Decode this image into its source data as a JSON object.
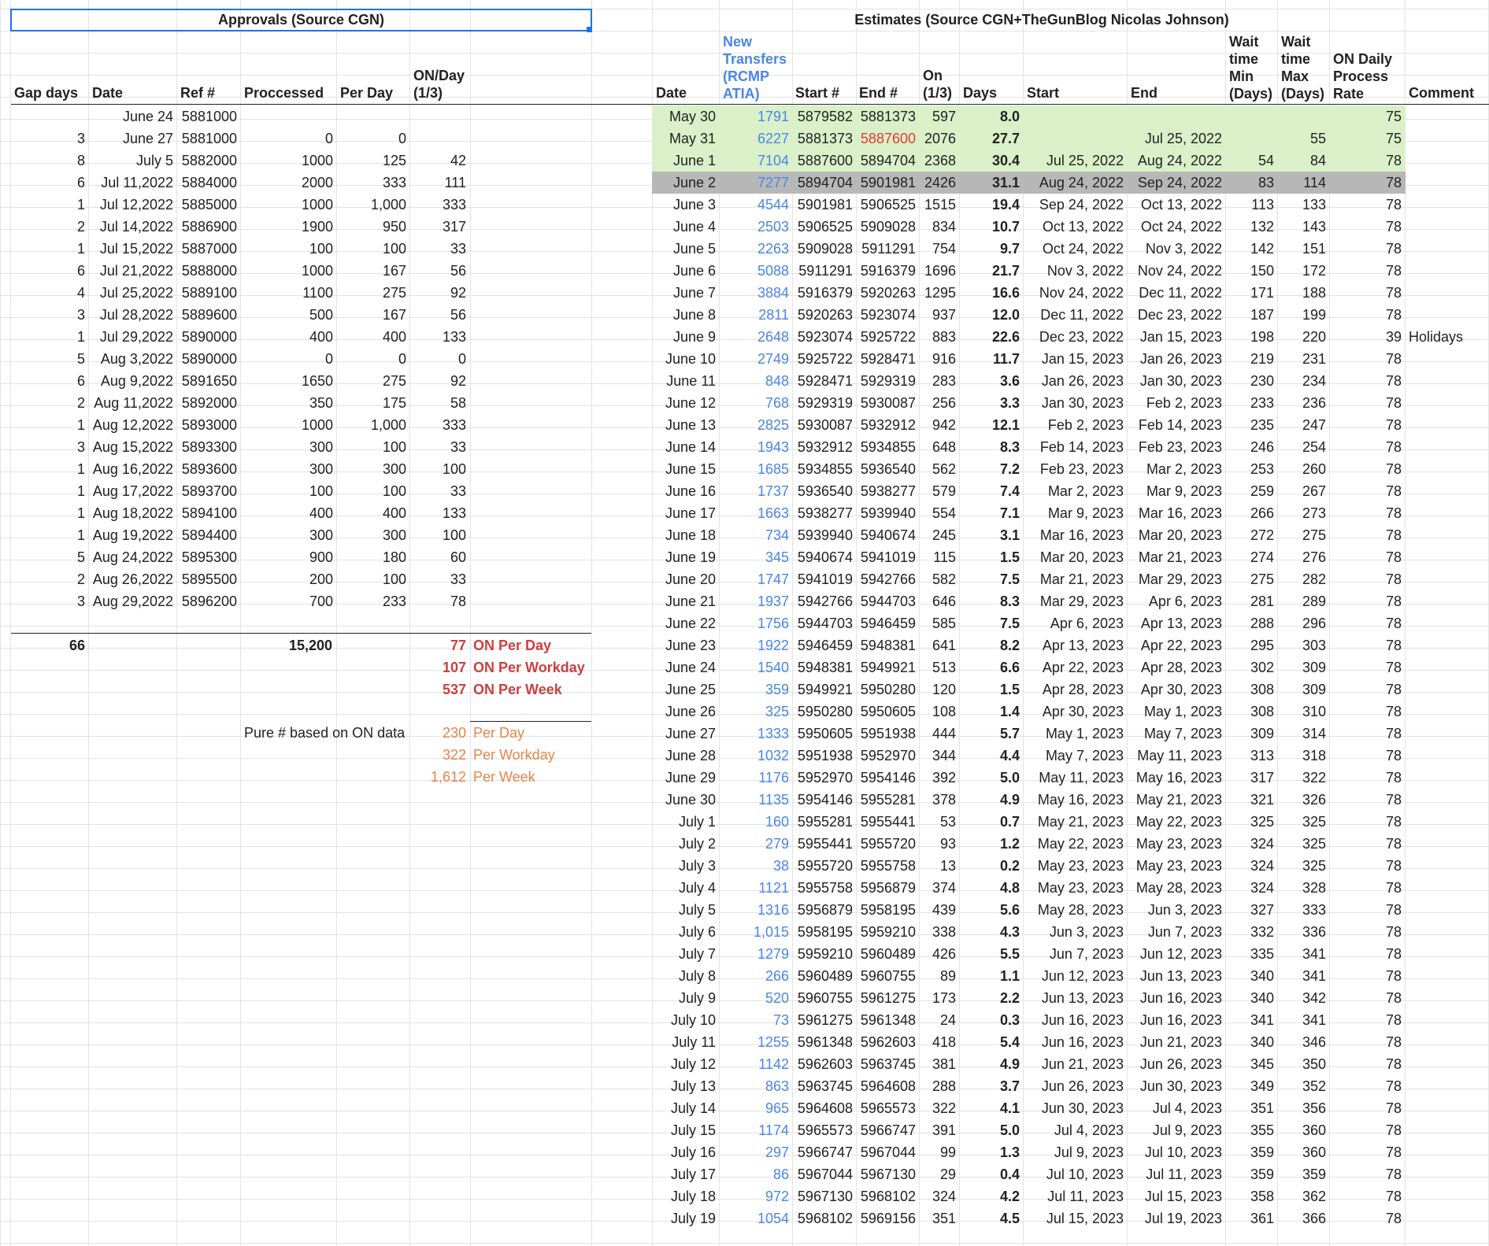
{
  "titles": {
    "approvals": "Approvals (Source CGN)",
    "estimates": "Estimates (Source CGN+TheGunBlog Nicolas Johnson)"
  },
  "left_headers": [
    "Gap days",
    "Date",
    "Ref #",
    "Proccessed",
    "Per Day",
    "ON/Day (1/3)"
  ],
  "left_rows": [
    {
      "gap": "",
      "date": "June 24",
      "ref": "5881000",
      "processed": "",
      "per_day": "",
      "on_day": ""
    },
    {
      "gap": "3",
      "date": "June 27",
      "ref": "5881000",
      "processed": "0",
      "per_day": "0",
      "on_day": ""
    },
    {
      "gap": "8",
      "date": "July 5",
      "ref": "5882000",
      "processed": "1000",
      "per_day": "125",
      "on_day": "42"
    },
    {
      "gap": "6",
      "date": "Jul 11,2022",
      "ref": "5884000",
      "processed": "2000",
      "per_day": "333",
      "on_day": "111"
    },
    {
      "gap": "1",
      "date": "Jul 12,2022",
      "ref": "5885000",
      "processed": "1000",
      "per_day": "1,000",
      "on_day": "333"
    },
    {
      "gap": "2",
      "date": "Jul 14,2022",
      "ref": "5886900",
      "processed": "1900",
      "per_day": "950",
      "on_day": "317"
    },
    {
      "gap": "1",
      "date": "Jul 15,2022",
      "ref": "5887000",
      "processed": "100",
      "per_day": "100",
      "on_day": "33"
    },
    {
      "gap": "6",
      "date": "Jul 21,2022",
      "ref": "5888000",
      "processed": "1000",
      "per_day": "167",
      "on_day": "56"
    },
    {
      "gap": "4",
      "date": "Jul 25,2022",
      "ref": "5889100",
      "processed": "1100",
      "per_day": "275",
      "on_day": "92"
    },
    {
      "gap": "3",
      "date": "Jul 28,2022",
      "ref": "5889600",
      "processed": "500",
      "per_day": "167",
      "on_day": "56"
    },
    {
      "gap": "1",
      "date": "Jul 29,2022",
      "ref": "5890000",
      "processed": "400",
      "per_day": "400",
      "on_day": "133"
    },
    {
      "gap": "5",
      "date": "Aug 3,2022",
      "ref": "5890000",
      "processed": "0",
      "per_day": "0",
      "on_day": "0"
    },
    {
      "gap": "6",
      "date": "Aug 9,2022",
      "ref": "5891650",
      "processed": "1650",
      "per_day": "275",
      "on_day": "92"
    },
    {
      "gap": "2",
      "date": "Aug 11,2022",
      "ref": "5892000",
      "processed": "350",
      "per_day": "175",
      "on_day": "58"
    },
    {
      "gap": "1",
      "date": "Aug 12,2022",
      "ref": "5893000",
      "processed": "1000",
      "per_day": "1,000",
      "on_day": "333"
    },
    {
      "gap": "3",
      "date": "Aug 15,2022",
      "ref": "5893300",
      "processed": "300",
      "per_day": "100",
      "on_day": "33"
    },
    {
      "gap": "1",
      "date": "Aug 16,2022",
      "ref": "5893600",
      "processed": "300",
      "per_day": "300",
      "on_day": "100"
    },
    {
      "gap": "1",
      "date": "Aug 17,2022",
      "ref": "5893700",
      "processed": "100",
      "per_day": "100",
      "on_day": "33"
    },
    {
      "gap": "1",
      "date": "Aug 18,2022",
      "ref": "5894100",
      "processed": "400",
      "per_day": "400",
      "on_day": "133"
    },
    {
      "gap": "1",
      "date": "Aug 19,2022",
      "ref": "5894400",
      "processed": "300",
      "per_day": "300",
      "on_day": "100"
    },
    {
      "gap": "5",
      "date": "Aug 24,2022",
      "ref": "5895300",
      "processed": "900",
      "per_day": "180",
      "on_day": "60"
    },
    {
      "gap": "2",
      "date": "Aug 26,2022",
      "ref": "5895500",
      "processed": "200",
      "per_day": "100",
      "on_day": "33"
    },
    {
      "gap": "3",
      "date": "Aug 29,2022",
      "ref": "5896200",
      "processed": "700",
      "per_day": "233",
      "on_day": "78"
    }
  ],
  "totals": {
    "gap_total": "66",
    "processed_total": "15,200",
    "on_per_day_value": "77",
    "on_per_day_label": "ON Per Day",
    "on_per_workday_value": "107",
    "on_per_workday_label": "ON Per Workday",
    "on_per_week_value": "537",
    "on_per_week_label": "ON Per Week",
    "pure_label": "Pure # based on ON data",
    "pure_per_day_value": "230",
    "pure_per_day_label": "Per Day",
    "pure_per_workday_value": "322",
    "pure_per_workday_label": "Per Workday",
    "pure_per_week_value": "1,612",
    "pure_per_week_label": "Per Week"
  },
  "right_headers": [
    "Date",
    "New Transfers (RCMP ATIA)",
    "Start #",
    "End #",
    "On (1/3)",
    "Days",
    "Start",
    "End",
    "Wait time Min (Days)",
    "Wait time Max (Days)",
    "ON Daily Process Rate",
    "Comment"
  ],
  "right_rows": [
    {
      "date": "May 30",
      "new": "1791",
      "start_n": "5879582",
      "end_n": "5881373",
      "on": "597",
      "days": "8.0",
      "start": "",
      "end": "",
      "wmin": "",
      "wmax": "",
      "rate": "75",
      "comment": "",
      "hl": "green"
    },
    {
      "date": "May 31",
      "new": "6227",
      "start_n": "5881373",
      "end_n": "5887600",
      "on": "2076",
      "days": "27.7",
      "start": "",
      "end": "Jul 25, 2022",
      "wmin": "",
      "wmax": "55",
      "rate": "75",
      "comment": "",
      "hl": "green",
      "end_red": true
    },
    {
      "date": "June 1",
      "new": "7104",
      "start_n": "5887600",
      "end_n": "5894704",
      "on": "2368",
      "days": "30.4",
      "start": "Jul 25, 2022",
      "end": "Aug 24, 2022",
      "wmin": "54",
      "wmax": "84",
      "rate": "78",
      "comment": "",
      "hl": "green"
    },
    {
      "date": "June 2",
      "new": "7277",
      "start_n": "5894704",
      "end_n": "5901981",
      "on": "2426",
      "days": "31.1",
      "start": "Aug 24, 2022",
      "end": "Sep 24, 2022",
      "wmin": "83",
      "wmax": "114",
      "rate": "78",
      "comment": "",
      "hl": "gray"
    },
    {
      "date": "June 3",
      "new": "4544",
      "start_n": "5901981",
      "end_n": "5906525",
      "on": "1515",
      "days": "19.4",
      "start": "Sep 24, 2022",
      "end": "Oct 13, 2022",
      "wmin": "113",
      "wmax": "133",
      "rate": "78",
      "comment": ""
    },
    {
      "date": "June 4",
      "new": "2503",
      "start_n": "5906525",
      "end_n": "5909028",
      "on": "834",
      "days": "10.7",
      "start": "Oct 13, 2022",
      "end": "Oct 24, 2022",
      "wmin": "132",
      "wmax": "143",
      "rate": "78",
      "comment": ""
    },
    {
      "date": "June 5",
      "new": "2263",
      "start_n": "5909028",
      "end_n": "5911291",
      "on": "754",
      "days": "9.7",
      "start": "Oct 24, 2022",
      "end": "Nov 3, 2022",
      "wmin": "142",
      "wmax": "151",
      "rate": "78",
      "comment": ""
    },
    {
      "date": "June 6",
      "new": "5088",
      "start_n": "5911291",
      "end_n": "5916379",
      "on": "1696",
      "days": "21.7",
      "start": "Nov 3, 2022",
      "end": "Nov 24, 2022",
      "wmin": "150",
      "wmax": "172",
      "rate": "78",
      "comment": ""
    },
    {
      "date": "June 7",
      "new": "3884",
      "start_n": "5916379",
      "end_n": "5920263",
      "on": "1295",
      "days": "16.6",
      "start": "Nov 24, 2022",
      "end": "Dec 11, 2022",
      "wmin": "171",
      "wmax": "188",
      "rate": "78",
      "comment": ""
    },
    {
      "date": "June 8",
      "new": "2811",
      "start_n": "5920263",
      "end_n": "5923074",
      "on": "937",
      "days": "12.0",
      "start": "Dec 11, 2022",
      "end": "Dec 23, 2022",
      "wmin": "187",
      "wmax": "199",
      "rate": "78",
      "comment": ""
    },
    {
      "date": "June 9",
      "new": "2648",
      "start_n": "5923074",
      "end_n": "5925722",
      "on": "883",
      "days": "22.6",
      "start": "Dec 23, 2022",
      "end": "Jan 15, 2023",
      "wmin": "198",
      "wmax": "220",
      "rate": "39",
      "comment": "Holidays"
    },
    {
      "date": "June 10",
      "new": "2749",
      "start_n": "5925722",
      "end_n": "5928471",
      "on": "916",
      "days": "11.7",
      "start": "Jan 15, 2023",
      "end": "Jan 26, 2023",
      "wmin": "219",
      "wmax": "231",
      "rate": "78",
      "comment": ""
    },
    {
      "date": "June 11",
      "new": "848",
      "start_n": "5928471",
      "end_n": "5929319",
      "on": "283",
      "days": "3.6",
      "start": "Jan 26, 2023",
      "end": "Jan 30, 2023",
      "wmin": "230",
      "wmax": "234",
      "rate": "78",
      "comment": ""
    },
    {
      "date": "June 12",
      "new": "768",
      "start_n": "5929319",
      "end_n": "5930087",
      "on": "256",
      "days": "3.3",
      "start": "Jan 30, 2023",
      "end": "Feb 2, 2023",
      "wmin": "233",
      "wmax": "236",
      "rate": "78",
      "comment": ""
    },
    {
      "date": "June 13",
      "new": "2825",
      "start_n": "5930087",
      "end_n": "5932912",
      "on": "942",
      "days": "12.1",
      "start": "Feb 2, 2023",
      "end": "Feb 14, 2023",
      "wmin": "235",
      "wmax": "247",
      "rate": "78",
      "comment": ""
    },
    {
      "date": "June 14",
      "new": "1943",
      "start_n": "5932912",
      "end_n": "5934855",
      "on": "648",
      "days": "8.3",
      "start": "Feb 14, 2023",
      "end": "Feb 23, 2023",
      "wmin": "246",
      "wmax": "254",
      "rate": "78",
      "comment": ""
    },
    {
      "date": "June 15",
      "new": "1685",
      "start_n": "5934855",
      "end_n": "5936540",
      "on": "562",
      "days": "7.2",
      "start": "Feb 23, 2023",
      "end": "Mar 2, 2023",
      "wmin": "253",
      "wmax": "260",
      "rate": "78",
      "comment": ""
    },
    {
      "date": "June 16",
      "new": "1737",
      "start_n": "5936540",
      "end_n": "5938277",
      "on": "579",
      "days": "7.4",
      "start": "Mar 2, 2023",
      "end": "Mar 9, 2023",
      "wmin": "259",
      "wmax": "267",
      "rate": "78",
      "comment": ""
    },
    {
      "date": "June 17",
      "new": "1663",
      "start_n": "5938277",
      "end_n": "5939940",
      "on": "554",
      "days": "7.1",
      "start": "Mar 9, 2023",
      "end": "Mar 16, 2023",
      "wmin": "266",
      "wmax": "273",
      "rate": "78",
      "comment": ""
    },
    {
      "date": "June 18",
      "new": "734",
      "start_n": "5939940",
      "end_n": "5940674",
      "on": "245",
      "days": "3.1",
      "start": "Mar 16, 2023",
      "end": "Mar 20, 2023",
      "wmin": "272",
      "wmax": "275",
      "rate": "78",
      "comment": ""
    },
    {
      "date": "June 19",
      "new": "345",
      "start_n": "5940674",
      "end_n": "5941019",
      "on": "115",
      "days": "1.5",
      "start": "Mar 20, 2023",
      "end": "Mar 21, 2023",
      "wmin": "274",
      "wmax": "276",
      "rate": "78",
      "comment": ""
    },
    {
      "date": "June 20",
      "new": "1747",
      "start_n": "5941019",
      "end_n": "5942766",
      "on": "582",
      "days": "7.5",
      "start": "Mar 21, 2023",
      "end": "Mar 29, 2023",
      "wmin": "275",
      "wmax": "282",
      "rate": "78",
      "comment": ""
    },
    {
      "date": "June 21",
      "new": "1937",
      "start_n": "5942766",
      "end_n": "5944703",
      "on": "646",
      "days": "8.3",
      "start": "Mar 29, 2023",
      "end": "Apr 6, 2023",
      "wmin": "281",
      "wmax": "289",
      "rate": "78",
      "comment": ""
    },
    {
      "date": "June 22",
      "new": "1756",
      "start_n": "5944703",
      "end_n": "5946459",
      "on": "585",
      "days": "7.5",
      "start": "Apr 6, 2023",
      "end": "Apr 13, 2023",
      "wmin": "288",
      "wmax": "296",
      "rate": "78",
      "comment": ""
    },
    {
      "date": "June 23",
      "new": "1922",
      "start_n": "5946459",
      "end_n": "5948381",
      "on": "641",
      "days": "8.2",
      "start": "Apr 13, 2023",
      "end": "Apr 22, 2023",
      "wmin": "295",
      "wmax": "303",
      "rate": "78",
      "comment": ""
    },
    {
      "date": "June 24",
      "new": "1540",
      "start_n": "5948381",
      "end_n": "5949921",
      "on": "513",
      "days": "6.6",
      "start": "Apr 22, 2023",
      "end": "Apr 28, 2023",
      "wmin": "302",
      "wmax": "309",
      "rate": "78",
      "comment": ""
    },
    {
      "date": "June 25",
      "new": "359",
      "start_n": "5949921",
      "end_n": "5950280",
      "on": "120",
      "days": "1.5",
      "start": "Apr 28, 2023",
      "end": "Apr 30, 2023",
      "wmin": "308",
      "wmax": "309",
      "rate": "78",
      "comment": ""
    },
    {
      "date": "June 26",
      "new": "325",
      "start_n": "5950280",
      "end_n": "5950605",
      "on": "108",
      "days": "1.4",
      "start": "Apr 30, 2023",
      "end": "May 1, 2023",
      "wmin": "308",
      "wmax": "310",
      "rate": "78",
      "comment": ""
    },
    {
      "date": "June 27",
      "new": "1333",
      "start_n": "5950605",
      "end_n": "5951938",
      "on": "444",
      "days": "5.7",
      "start": "May 1, 2023",
      "end": "May 7, 2023",
      "wmin": "309",
      "wmax": "314",
      "rate": "78",
      "comment": ""
    },
    {
      "date": "June 28",
      "new": "1032",
      "start_n": "5951938",
      "end_n": "5952970",
      "on": "344",
      "days": "4.4",
      "start": "May 7, 2023",
      "end": "May 11, 2023",
      "wmin": "313",
      "wmax": "318",
      "rate": "78",
      "comment": ""
    },
    {
      "date": "June 29",
      "new": "1176",
      "start_n": "5952970",
      "end_n": "5954146",
      "on": "392",
      "days": "5.0",
      "start": "May 11, 2023",
      "end": "May 16, 2023",
      "wmin": "317",
      "wmax": "322",
      "rate": "78",
      "comment": ""
    },
    {
      "date": "June 30",
      "new": "1135",
      "start_n": "5954146",
      "end_n": "5955281",
      "on": "378",
      "days": "4.9",
      "start": "May 16, 2023",
      "end": "May 21, 2023",
      "wmin": "321",
      "wmax": "326",
      "rate": "78",
      "comment": ""
    },
    {
      "date": "July 1",
      "new": "160",
      "start_n": "5955281",
      "end_n": "5955441",
      "on": "53",
      "days": "0.7",
      "start": "May 21, 2023",
      "end": "May 22, 2023",
      "wmin": "325",
      "wmax": "325",
      "rate": "78",
      "comment": ""
    },
    {
      "date": "July 2",
      "new": "279",
      "start_n": "5955441",
      "end_n": "5955720",
      "on": "93",
      "days": "1.2",
      "start": "May 22, 2023",
      "end": "May 23, 2023",
      "wmin": "324",
      "wmax": "325",
      "rate": "78",
      "comment": ""
    },
    {
      "date": "July 3",
      "new": "38",
      "start_n": "5955720",
      "end_n": "5955758",
      "on": "13",
      "days": "0.2",
      "start": "May 23, 2023",
      "end": "May 23, 2023",
      "wmin": "324",
      "wmax": "325",
      "rate": "78",
      "comment": ""
    },
    {
      "date": "July 4",
      "new": "1121",
      "start_n": "5955758",
      "end_n": "5956879",
      "on": "374",
      "days": "4.8",
      "start": "May 23, 2023",
      "end": "May 28, 2023",
      "wmin": "324",
      "wmax": "328",
      "rate": "78",
      "comment": ""
    },
    {
      "date": "July 5",
      "new": "1316",
      "start_n": "5956879",
      "end_n": "5958195",
      "on": "439",
      "days": "5.6",
      "start": "May 28, 2023",
      "end": "Jun 3, 2023",
      "wmin": "327",
      "wmax": "333",
      "rate": "78",
      "comment": ""
    },
    {
      "date": "July 6",
      "new": "1,015",
      "start_n": "5958195",
      "end_n": "5959210",
      "on": "338",
      "days": "4.3",
      "start": "Jun 3, 2023",
      "end": "Jun 7, 2023",
      "wmin": "332",
      "wmax": "336",
      "rate": "78",
      "comment": ""
    },
    {
      "date": "July 7",
      "new": "1279",
      "start_n": "5959210",
      "end_n": "5960489",
      "on": "426",
      "days": "5.5",
      "start": "Jun 7, 2023",
      "end": "Jun 12, 2023",
      "wmin": "335",
      "wmax": "341",
      "rate": "78",
      "comment": ""
    },
    {
      "date": "July 8",
      "new": "266",
      "start_n": "5960489",
      "end_n": "5960755",
      "on": "89",
      "days": "1.1",
      "start": "Jun 12, 2023",
      "end": "Jun 13, 2023",
      "wmin": "340",
      "wmax": "341",
      "rate": "78",
      "comment": ""
    },
    {
      "date": "July 9",
      "new": "520",
      "start_n": "5960755",
      "end_n": "5961275",
      "on": "173",
      "days": "2.2",
      "start": "Jun 13, 2023",
      "end": "Jun 16, 2023",
      "wmin": "340",
      "wmax": "342",
      "rate": "78",
      "comment": ""
    },
    {
      "date": "July 10",
      "new": "73",
      "start_n": "5961275",
      "end_n": "5961348",
      "on": "24",
      "days": "0.3",
      "start": "Jun 16, 2023",
      "end": "Jun 16, 2023",
      "wmin": "341",
      "wmax": "341",
      "rate": "78",
      "comment": ""
    },
    {
      "date": "July 11",
      "new": "1255",
      "start_n": "5961348",
      "end_n": "5962603",
      "on": "418",
      "days": "5.4",
      "start": "Jun 16, 2023",
      "end": "Jun 21, 2023",
      "wmin": "340",
      "wmax": "346",
      "rate": "78",
      "comment": ""
    },
    {
      "date": "July 12",
      "new": "1142",
      "start_n": "5962603",
      "end_n": "5963745",
      "on": "381",
      "days": "4.9",
      "start": "Jun 21, 2023",
      "end": "Jun 26, 2023",
      "wmin": "345",
      "wmax": "350",
      "rate": "78",
      "comment": ""
    },
    {
      "date": "July 13",
      "new": "863",
      "start_n": "5963745",
      "end_n": "5964608",
      "on": "288",
      "days": "3.7",
      "start": "Jun 26, 2023",
      "end": "Jun 30, 2023",
      "wmin": "349",
      "wmax": "352",
      "rate": "78",
      "comment": ""
    },
    {
      "date": "July 14",
      "new": "965",
      "start_n": "5964608",
      "end_n": "5965573",
      "on": "322",
      "days": "4.1",
      "start": "Jun 30, 2023",
      "end": "Jul 4, 2023",
      "wmin": "351",
      "wmax": "356",
      "rate": "78",
      "comment": ""
    },
    {
      "date": "July 15",
      "new": "1174",
      "start_n": "5965573",
      "end_n": "5966747",
      "on": "391",
      "days": "5.0",
      "start": "Jul 4, 2023",
      "end": "Jul 9, 2023",
      "wmin": "355",
      "wmax": "360",
      "rate": "78",
      "comment": ""
    },
    {
      "date": "July 16",
      "new": "297",
      "start_n": "5966747",
      "end_n": "5967044",
      "on": "99",
      "days": "1.3",
      "start": "Jul 9, 2023",
      "end": "Jul 10, 2023",
      "wmin": "359",
      "wmax": "360",
      "rate": "78",
      "comment": ""
    },
    {
      "date": "July 17",
      "new": "86",
      "start_n": "5967044",
      "end_n": "5967130",
      "on": "29",
      "days": "0.4",
      "start": "Jul 10, 2023",
      "end": "Jul 11, 2023",
      "wmin": "359",
      "wmax": "359",
      "rate": "78",
      "comment": ""
    },
    {
      "date": "July 18",
      "new": "972",
      "start_n": "5967130",
      "end_n": "5968102",
      "on": "324",
      "days": "4.2",
      "start": "Jul 11, 2023",
      "end": "Jul 15, 2023",
      "wmin": "358",
      "wmax": "362",
      "rate": "78",
      "comment": ""
    },
    {
      "date": "July 19",
      "new": "1054",
      "start_n": "5968102",
      "end_n": "5969156",
      "on": "351",
      "days": "4.5",
      "start": "Jul 15, 2023",
      "end": "Jul 19, 2023",
      "wmin": "361",
      "wmax": "366",
      "rate": "78",
      "comment": ""
    }
  ]
}
